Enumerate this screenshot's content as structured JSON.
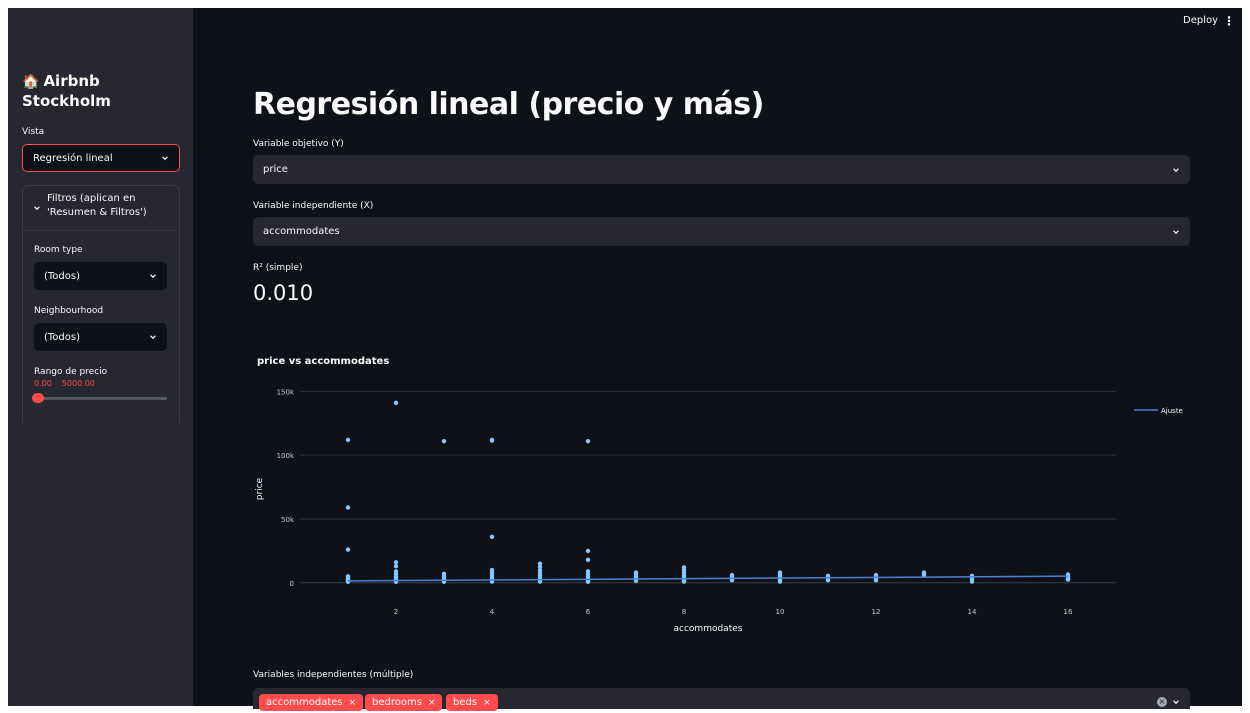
{
  "header": {
    "deploy_label": "Deploy",
    "menu_glyph": "⋮"
  },
  "sidebar": {
    "app_title": "Airbnb Stockholm",
    "house_icon": "🏠",
    "vista_label": "Vista",
    "vista_selected": "Regresión lineal",
    "filters_expander_title": "Filtros (aplican en 'Resumen & Filtros')",
    "room_type_label": "Room type",
    "room_type_selected": "(Todos)",
    "neighbourhood_label": "Neighbourhood",
    "neighbourhood_selected": "(Todos)",
    "price_range_label": "Rango de precio",
    "price_min_text": "0.00",
    "price_max_text": "5000.00",
    "slider_low": 0,
    "slider_high": 5000,
    "slider_min": 0,
    "slider_max": 150000
  },
  "main": {
    "title": "Regresión lineal (precio y más)",
    "target_label": "Variable objetivo (Y)",
    "target_selected": "price",
    "indep_label": "Variable independiente (X)",
    "indep_selected": "accommodates",
    "r2_label": "R² (simple)",
    "r2_value": "0.010",
    "multi_label": "Variables independientes (múltiple)",
    "multi_tags": [
      {
        "label": "accommodates",
        "remove": "×"
      },
      {
        "label": "bedrooms",
        "remove": "×"
      },
      {
        "label": "beds",
        "remove": "×"
      }
    ],
    "clear_glyph": "×"
  },
  "colors": {
    "accent": "#ff4b4b",
    "point": "#83c9ff",
    "fit_line": "#4e7fd6",
    "background": "#0e1117",
    "panel": "#262730"
  },
  "chart_data": {
    "type": "scatter",
    "title": "price vs accommodates",
    "xlabel": "accommodates",
    "ylabel": "price",
    "xlim": [
      0,
      17
    ],
    "ylim": [
      -8000,
      155000
    ],
    "x_ticks": [
      2,
      4,
      6,
      8,
      10,
      12,
      14,
      16
    ],
    "y_ticks": [
      0,
      50000,
      100000,
      150000
    ],
    "y_tick_labels": [
      "0",
      "50k",
      "100k",
      "150k"
    ],
    "legend": {
      "position": "top-right",
      "entries": [
        "Ajuste"
      ]
    },
    "grid": true,
    "series": [
      {
        "kind": "points",
        "points": [
          [
            1,
            112000
          ],
          [
            1,
            59000
          ],
          [
            1,
            26000
          ],
          [
            1,
            5000
          ],
          [
            1,
            3500
          ],
          [
            1,
            2500
          ],
          [
            1,
            1500
          ],
          [
            1,
            800
          ],
          [
            2,
            141000
          ],
          [
            2,
            16000
          ],
          [
            2,
            13000
          ],
          [
            2,
            9000
          ],
          [
            2,
            7000
          ],
          [
            2,
            5000
          ],
          [
            2,
            3500
          ],
          [
            2,
            2500
          ],
          [
            2,
            1500
          ],
          [
            2,
            800
          ],
          [
            3,
            111000
          ],
          [
            3,
            7000
          ],
          [
            3,
            5000
          ],
          [
            3,
            3500
          ],
          [
            3,
            2500
          ],
          [
            3,
            1500
          ],
          [
            3,
            800
          ],
          [
            4,
            112000
          ],
          [
            4,
            111500
          ],
          [
            4,
            36000
          ],
          [
            4,
            10000
          ],
          [
            4,
            8000
          ],
          [
            4,
            6000
          ],
          [
            4,
            4500
          ],
          [
            4,
            3000
          ],
          [
            4,
            2000
          ],
          [
            4,
            1000
          ],
          [
            5,
            15000
          ],
          [
            5,
            12500
          ],
          [
            5,
            10000
          ],
          [
            5,
            8000
          ],
          [
            5,
            6000
          ],
          [
            5,
            4500
          ],
          [
            5,
            3000
          ],
          [
            5,
            2000
          ],
          [
            5,
            1000
          ],
          [
            6,
            111000
          ],
          [
            6,
            25000
          ],
          [
            6,
            18000
          ],
          [
            6,
            9000
          ],
          [
            6,
            7000
          ],
          [
            6,
            5000
          ],
          [
            6,
            3500
          ],
          [
            6,
            2500
          ],
          [
            6,
            1500
          ],
          [
            6,
            800
          ],
          [
            7,
            8000
          ],
          [
            7,
            6500
          ],
          [
            7,
            5000
          ],
          [
            7,
            3500
          ],
          [
            7,
            2500
          ],
          [
            7,
            1500
          ],
          [
            8,
            12000
          ],
          [
            8,
            10000
          ],
          [
            8,
            8000
          ],
          [
            8,
            6000
          ],
          [
            8,
            4500
          ],
          [
            8,
            3000
          ],
          [
            8,
            2000
          ],
          [
            8,
            1000
          ],
          [
            9,
            6000
          ],
          [
            9,
            4500
          ],
          [
            9,
            3000
          ],
          [
            9,
            2000
          ],
          [
            10,
            8000
          ],
          [
            10,
            6000
          ],
          [
            10,
            4500
          ],
          [
            10,
            3000
          ],
          [
            10,
            2000
          ],
          [
            10,
            1000
          ],
          [
            11,
            5500
          ],
          [
            11,
            4000
          ],
          [
            11,
            3000
          ],
          [
            11,
            2000
          ],
          [
            12,
            6000
          ],
          [
            12,
            4500
          ],
          [
            12,
            3000
          ],
          [
            12,
            2000
          ],
          [
            13,
            8000
          ],
          [
            13,
            6500
          ],
          [
            13,
            5500
          ],
          [
            14,
            5500
          ],
          [
            14,
            4000
          ],
          [
            14,
            3000
          ],
          [
            14,
            1000
          ],
          [
            16,
            6500
          ],
          [
            16,
            5000
          ],
          [
            16,
            3500
          ],
          [
            16,
            2500
          ]
        ]
      },
      {
        "kind": "line",
        "name": "Ajuste",
        "points": [
          [
            1,
            1500
          ],
          [
            16,
            5200
          ]
        ]
      }
    ]
  }
}
